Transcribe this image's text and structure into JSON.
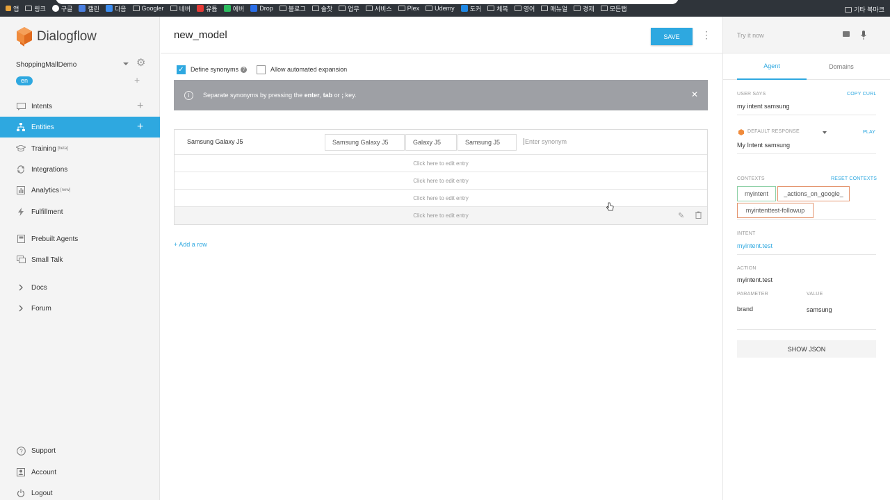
{
  "browser": {
    "bookmarks": [
      "앱",
      "링크",
      "구글",
      "캘린",
      "다음",
      "Googler",
      "네버",
      "유튭",
      "에버",
      "Drop",
      "블로그",
      "솔찻",
      "업무",
      "서비스",
      "Plex",
      "Udemy",
      "도커",
      "체복",
      "영어",
      "매뉴얼",
      "경제",
      "모든탭"
    ],
    "other_bookmarks": "기타 북마크"
  },
  "sidebar": {
    "logo_text": "Dialogflow",
    "agent_name": "ShoppingMallDemo",
    "language": "en",
    "items": [
      {
        "label": "Intents",
        "icon": "intents-icon"
      },
      {
        "label": "Entities",
        "icon": "entities-icon"
      },
      {
        "label": "Training",
        "badge": "[beta]",
        "icon": "training-icon"
      },
      {
        "label": "Integrations",
        "icon": "integrations-icon"
      },
      {
        "label": "Analytics",
        "badge": "[new]",
        "icon": "analytics-icon"
      },
      {
        "label": "Fulfillment",
        "icon": "fulfillment-icon"
      },
      {
        "label": "Prebuilt Agents",
        "icon": "prebuilt-agents-icon"
      },
      {
        "label": "Small Talk",
        "icon": "small-talk-icon"
      },
      {
        "label": "Docs",
        "icon": "chevron-right-icon"
      },
      {
        "label": "Forum",
        "icon": "chevron-right-icon"
      }
    ],
    "bottom": [
      {
        "label": "Support",
        "icon": "help-circle-icon"
      },
      {
        "label": "Account",
        "icon": "account-icon"
      },
      {
        "label": "Logout",
        "icon": "power-icon"
      }
    ]
  },
  "main": {
    "title": "new_model",
    "save_label": "SAVE",
    "options": {
      "define_synonyms": "Define synonyms",
      "define_synonyms_checked": true,
      "allow_expansion": "Allow automated expansion",
      "allow_expansion_checked": false
    },
    "banner": {
      "pre": "Separate synonyms by pressing the ",
      "k1": "enter",
      "sep1": ", ",
      "k2": "tab",
      "sep2": " or ",
      "k3": ";",
      "post": " key."
    },
    "entries": {
      "reference": "Samsung Galaxy J5",
      "synonyms": [
        "Samsung Galaxy J5",
        "Galaxy J5",
        "Samsung J5"
      ],
      "synonym_placeholder": "Enter synonym",
      "empty_rows": [
        "Click here to edit entry",
        "Click here to edit entry",
        "Click here to edit entry",
        "Click here to edit entry"
      ]
    },
    "add_row": "+ Add a row"
  },
  "right": {
    "try_placeholder": "Try it now",
    "tabs": [
      "Agent",
      "Domains"
    ],
    "user_says_label": "USER SAYS",
    "copy_curl": "COPY CURL",
    "user_says": "my intent samsung",
    "default_response_label": "DEFAULT RESPONSE",
    "play": "PLAY",
    "default_response": "My Intent samsung",
    "contexts_label": "CONTEXTS",
    "reset_contexts": "RESET CONTEXTS",
    "contexts": [
      "myintent",
      "_actions_on_google_",
      "myintenttest-followup"
    ],
    "intent_label": "INTENT",
    "intent": "myintent.test",
    "action_label": "ACTION",
    "action": "myintent.test",
    "parameter_label": "PARAMETER",
    "value_label": "VALUE",
    "parameter": "brand",
    "value": "samsung",
    "show_json": "SHOW JSON"
  }
}
